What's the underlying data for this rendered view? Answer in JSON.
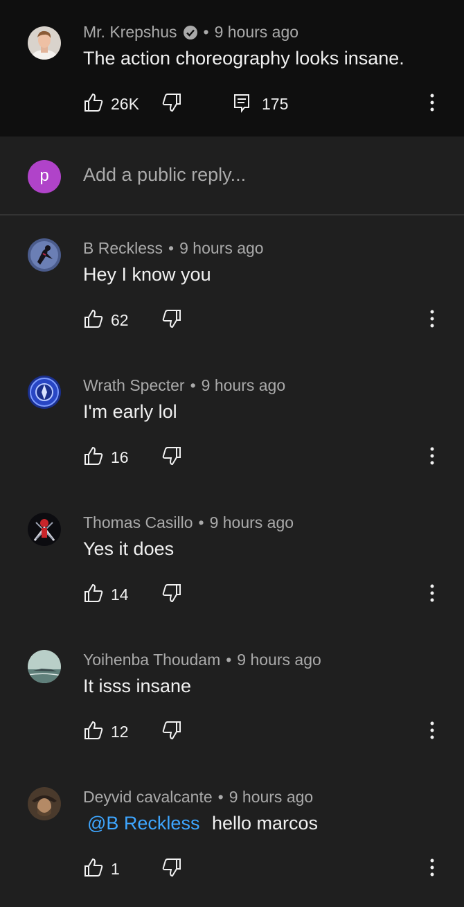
{
  "top_comment": {
    "author": "Mr. Krepshus",
    "separator": "•",
    "time": "9 hours ago",
    "text": "The action choreography looks insane.",
    "likes": "26K",
    "replies": "175"
  },
  "reply_box": {
    "avatar_letter": "p",
    "placeholder": "Add a public reply..."
  },
  "replies": [
    {
      "author": "B Reckless",
      "time": "9 hours ago",
      "text": "Hey I know you",
      "likes": "62"
    },
    {
      "author": "Wrath Specter",
      "time": "9 hours ago",
      "text": "I'm early lol",
      "likes": "16"
    },
    {
      "author": "Thomas Casillo",
      "time": "9 hours ago",
      "text": "Yes it does",
      "likes": "14"
    },
    {
      "author": "Yoihenba Thoudam",
      "time": "9 hours ago",
      "text": "It isss insane",
      "likes": "12"
    },
    {
      "author": "Deyvid cavalcante",
      "time": "9 hours ago",
      "mention": "@B Reckless",
      "text": "hello marcos",
      "likes": "1"
    }
  ],
  "colors": {
    "background": "#1f1f1f",
    "top_comment_bg": "#0f0f0f",
    "mention": "#3ea6ff",
    "reply_avatar": "#b043c9"
  }
}
